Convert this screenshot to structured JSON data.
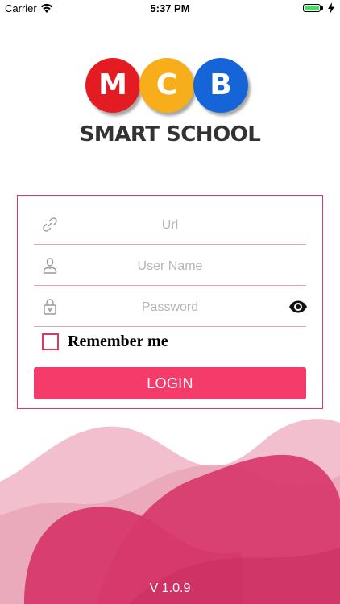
{
  "status_bar": {
    "carrier": "Carrier",
    "time": "5:37 PM",
    "battery_level_percent": 100,
    "wifi_icon": "wifi-icon",
    "charging_icon": "charging-bolt-icon"
  },
  "logo": {
    "letters": [
      "M",
      "C",
      "B"
    ],
    "letter_colors": [
      "#e31b23",
      "#f8ad1a",
      "#1565d8"
    ],
    "text": "SMART SCHOOL"
  },
  "form": {
    "url": {
      "placeholder": "Url",
      "value": "",
      "icon": "link-icon"
    },
    "username": {
      "placeholder": "User Name",
      "value": "",
      "icon": "user-icon"
    },
    "password": {
      "placeholder": "Password",
      "value": "",
      "icon": "lock-icon",
      "toggle_icon": "eye-icon"
    },
    "remember_label": "Remember me",
    "remember_checked": false,
    "login_label": "LOGIN"
  },
  "colors": {
    "accent": "#f53b6a",
    "card_border": "#d73a63",
    "wave_light": "#eeb3c3",
    "wave_dark": "#d8386c"
  },
  "version": "V 1.0.9"
}
